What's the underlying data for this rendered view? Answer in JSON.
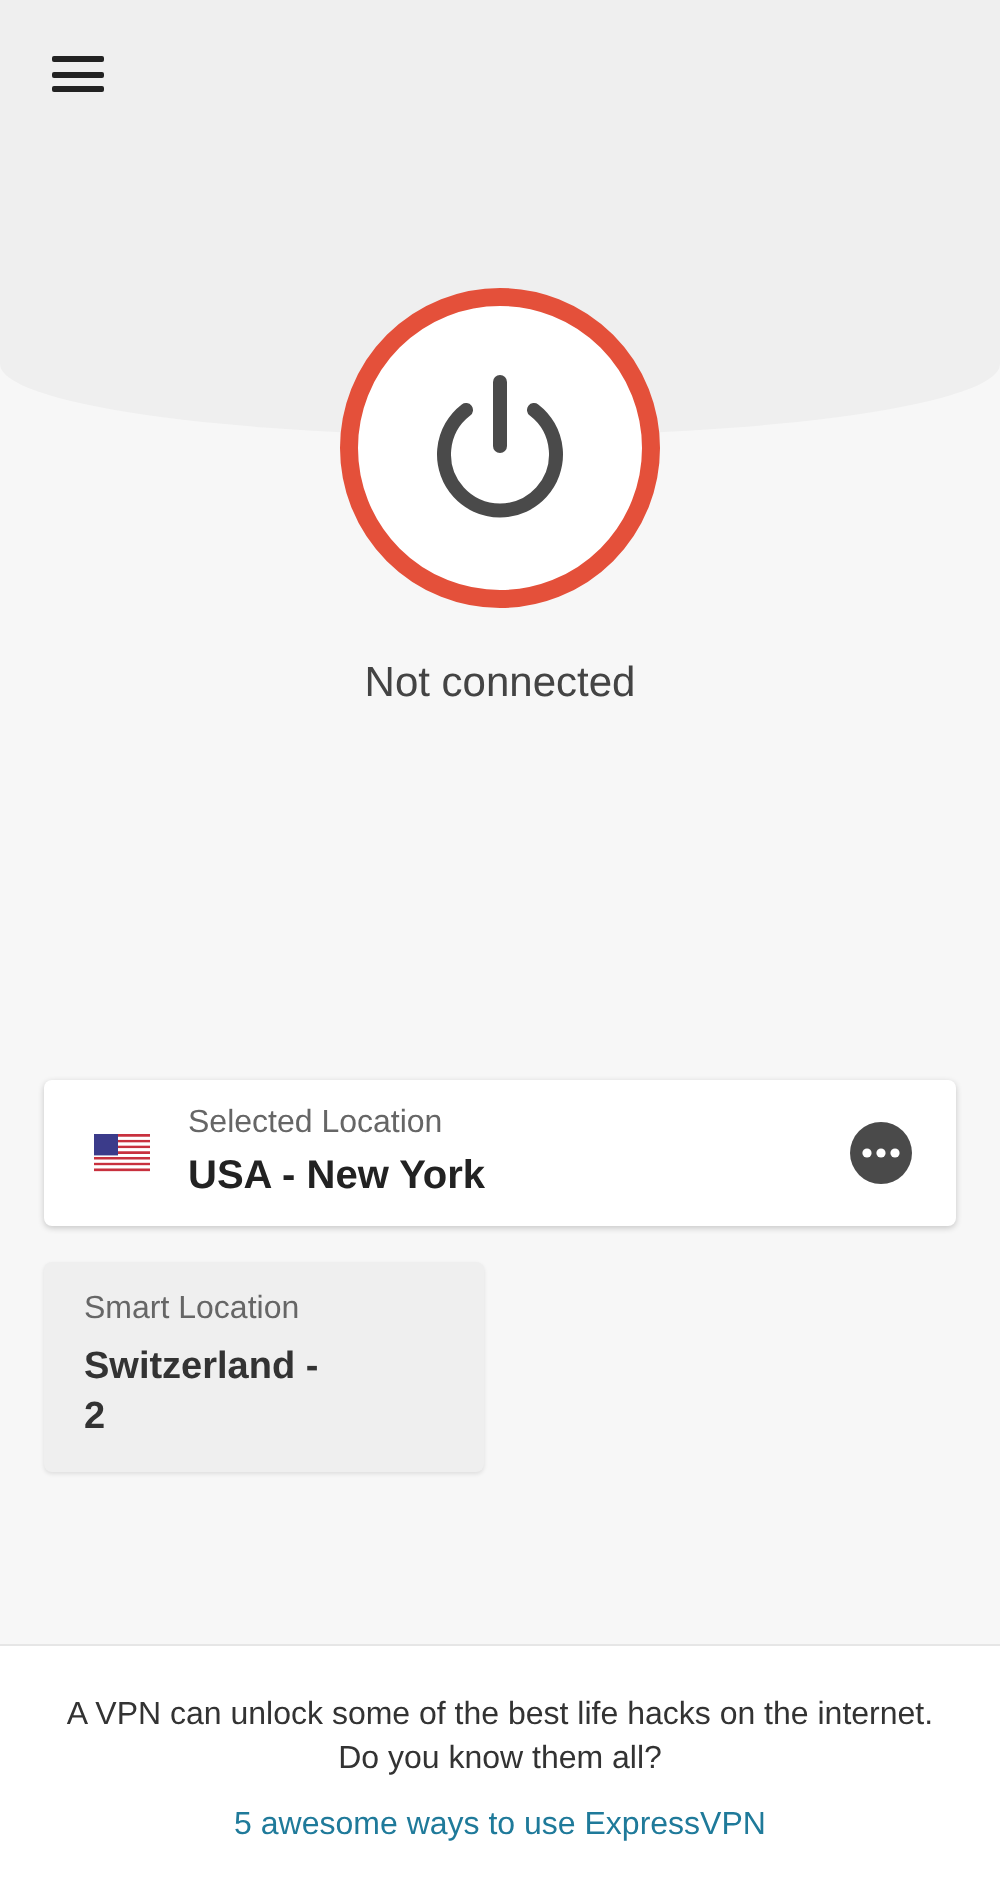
{
  "status": {
    "text": "Not connected",
    "connected": false
  },
  "selected_location": {
    "label": "Selected Location",
    "value": "USA - New York"
  },
  "smart_location": {
    "label": "Smart Location",
    "value": "Switzerland - 2"
  },
  "footer": {
    "text": "A VPN can unlock some of the best life hacks on the internet. Do you know them all?",
    "link": "5 awesome ways to use ExpressVPN"
  }
}
